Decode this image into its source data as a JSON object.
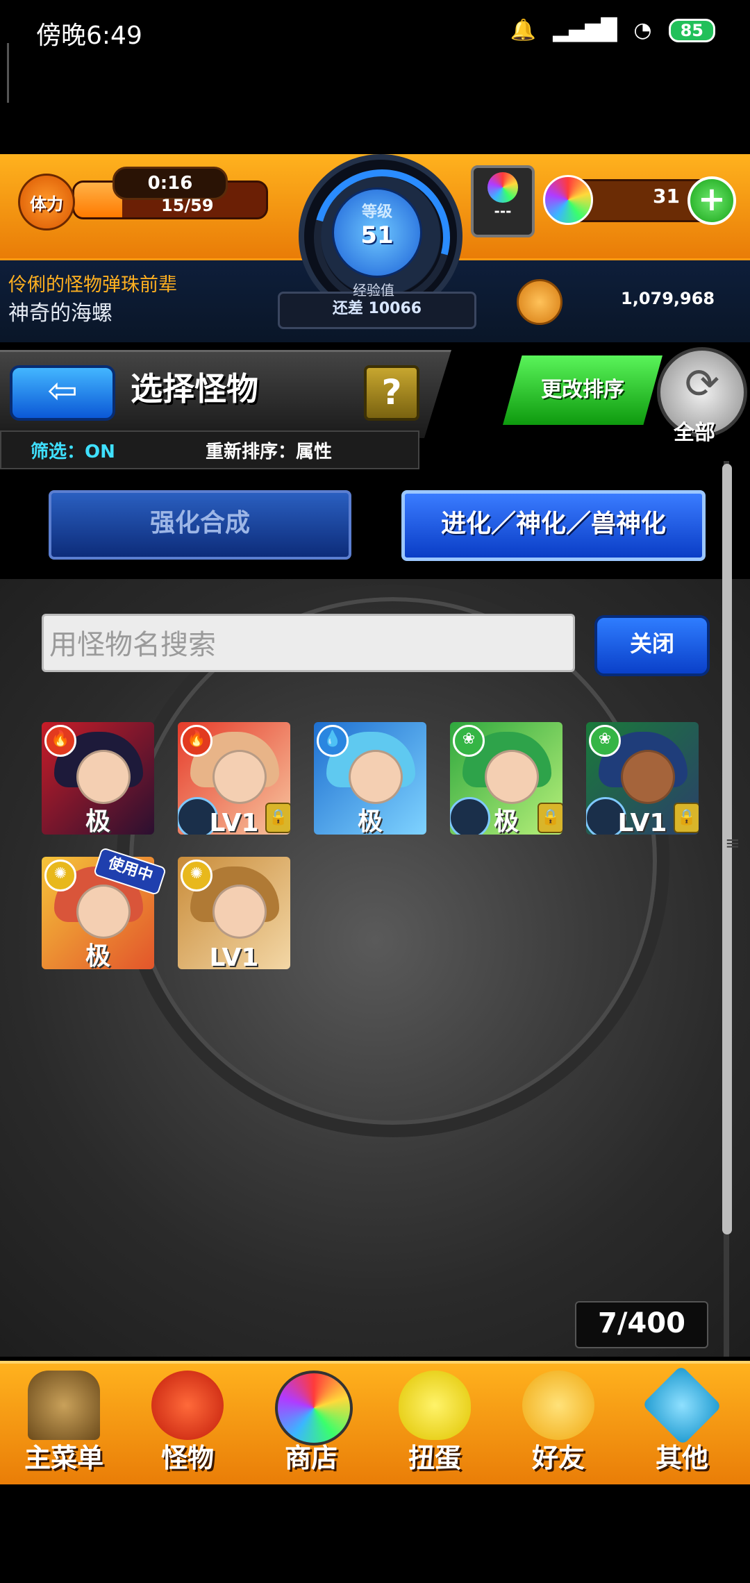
{
  "status_bar": {
    "time": "傍晚6:49",
    "battery": "85",
    "icons": [
      "bell-icon",
      "signal-icon",
      "wifi-icon",
      "battery-icon"
    ]
  },
  "hud": {
    "stamina_label": "体力",
    "stamina_timer": "0:16",
    "stamina_count": "15/59",
    "stamina_fraction": 0.25,
    "level_label": "等级",
    "level": "51",
    "exp_label": "经验值",
    "exp_remaining": "还差 10066",
    "gacha_dashes": "---",
    "orb_count": "31",
    "orb_plus": "+",
    "title_line1": "伶俐的怪物弹珠前辈",
    "title_line2": "神奇的海螺",
    "coins": "1,079,968"
  },
  "selector": {
    "back_symbol": "⇦",
    "title": "选择怪物",
    "help_symbol": "?",
    "filter": "筛选：ON",
    "sort": "重新排序：属性",
    "reorder_button": "更改排序",
    "all_button": "全部",
    "all_symbol": "⟳"
  },
  "tabs": [
    {
      "label": "强化合成",
      "active": false
    },
    {
      "label": "进化／神化／兽神化",
      "active": true
    }
  ],
  "search": {
    "placeholder": "用怪物名搜索",
    "close_button": "关闭"
  },
  "monsters": [
    {
      "element": "fire",
      "label": "极",
      "in_use": false,
      "locked": false
    },
    {
      "element": "fire",
      "label": "LV1",
      "in_use": false,
      "locked": true
    },
    {
      "element": "water",
      "label": "极",
      "in_use": false,
      "locked": false
    },
    {
      "element": "wood",
      "label": "极",
      "in_use": false,
      "locked": true
    },
    {
      "element": "wood",
      "label": "LV1",
      "in_use": false,
      "locked": true
    },
    {
      "element": "light",
      "label": "极",
      "in_use": true,
      "in_use_text": "使用中",
      "locked": false
    },
    {
      "element": "light",
      "label": "LV1",
      "in_use": false,
      "locked": false
    }
  ],
  "colors": {
    "fire": "#e23a1f",
    "water": "#2a86e0",
    "wood": "#35b545",
    "light": "#e8b81c",
    "accent": "#ff9a10"
  },
  "box_count": "7/400",
  "nav": [
    {
      "label": "主菜单",
      "icon": "castle-icon"
    },
    {
      "label": "怪物",
      "icon": "dragon-icon"
    },
    {
      "label": "商店",
      "icon": "orb-icon"
    },
    {
      "label": "扭蛋",
      "icon": "egg-icon"
    },
    {
      "label": "好友",
      "icon": "friends-icon"
    },
    {
      "label": "其他",
      "icon": "question-icon"
    }
  ]
}
